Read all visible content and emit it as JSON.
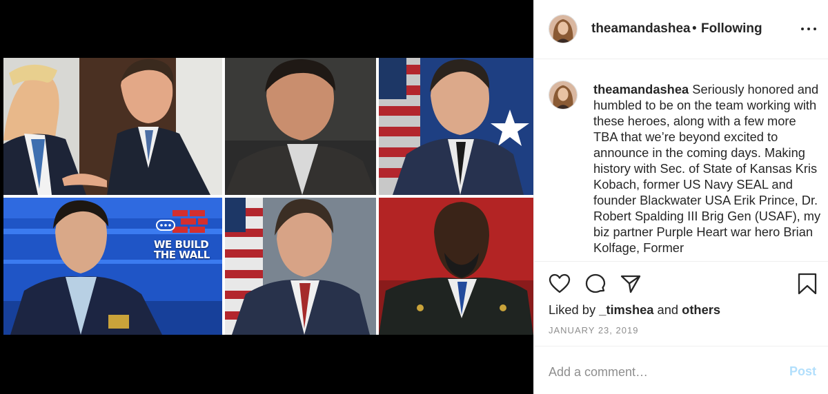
{
  "post": {
    "username": "theamandashea",
    "separator": "•",
    "follow_status": "Following",
    "caption_username": "theamandashea",
    "caption_text": "Seriously honored and humbled to be on the team working with these heroes, along with a few more TBA that we’re beyond excited to announce in the coming days. Making history with Sec. of State of Kansas Kris Kobach, former US Navy SEAL and founder Blackwater USA Erik Prince, Dr. Robert Spalding III Brig Gen (USAF), my biz partner Purple Heart war hero Brian Kolfage, Former",
    "liked_prefix": "Liked by",
    "liked_user": "_timshea",
    "liked_and": "and",
    "liked_others": "others",
    "date": "JANUARY 23, 2019"
  },
  "media": {
    "banner_line1": "WE BUILD",
    "banner_line2": "THE WALL"
  },
  "comment": {
    "placeholder": "Add a comment…",
    "post_label": "Post"
  },
  "icons": {
    "more": "more-options-icon",
    "like": "heart-icon",
    "comment": "comment-icon",
    "share": "share-icon",
    "save": "bookmark-icon"
  },
  "colors": {
    "post_button": "#b2dffc",
    "muted_text": "#8e8e8e",
    "text": "#262626"
  }
}
